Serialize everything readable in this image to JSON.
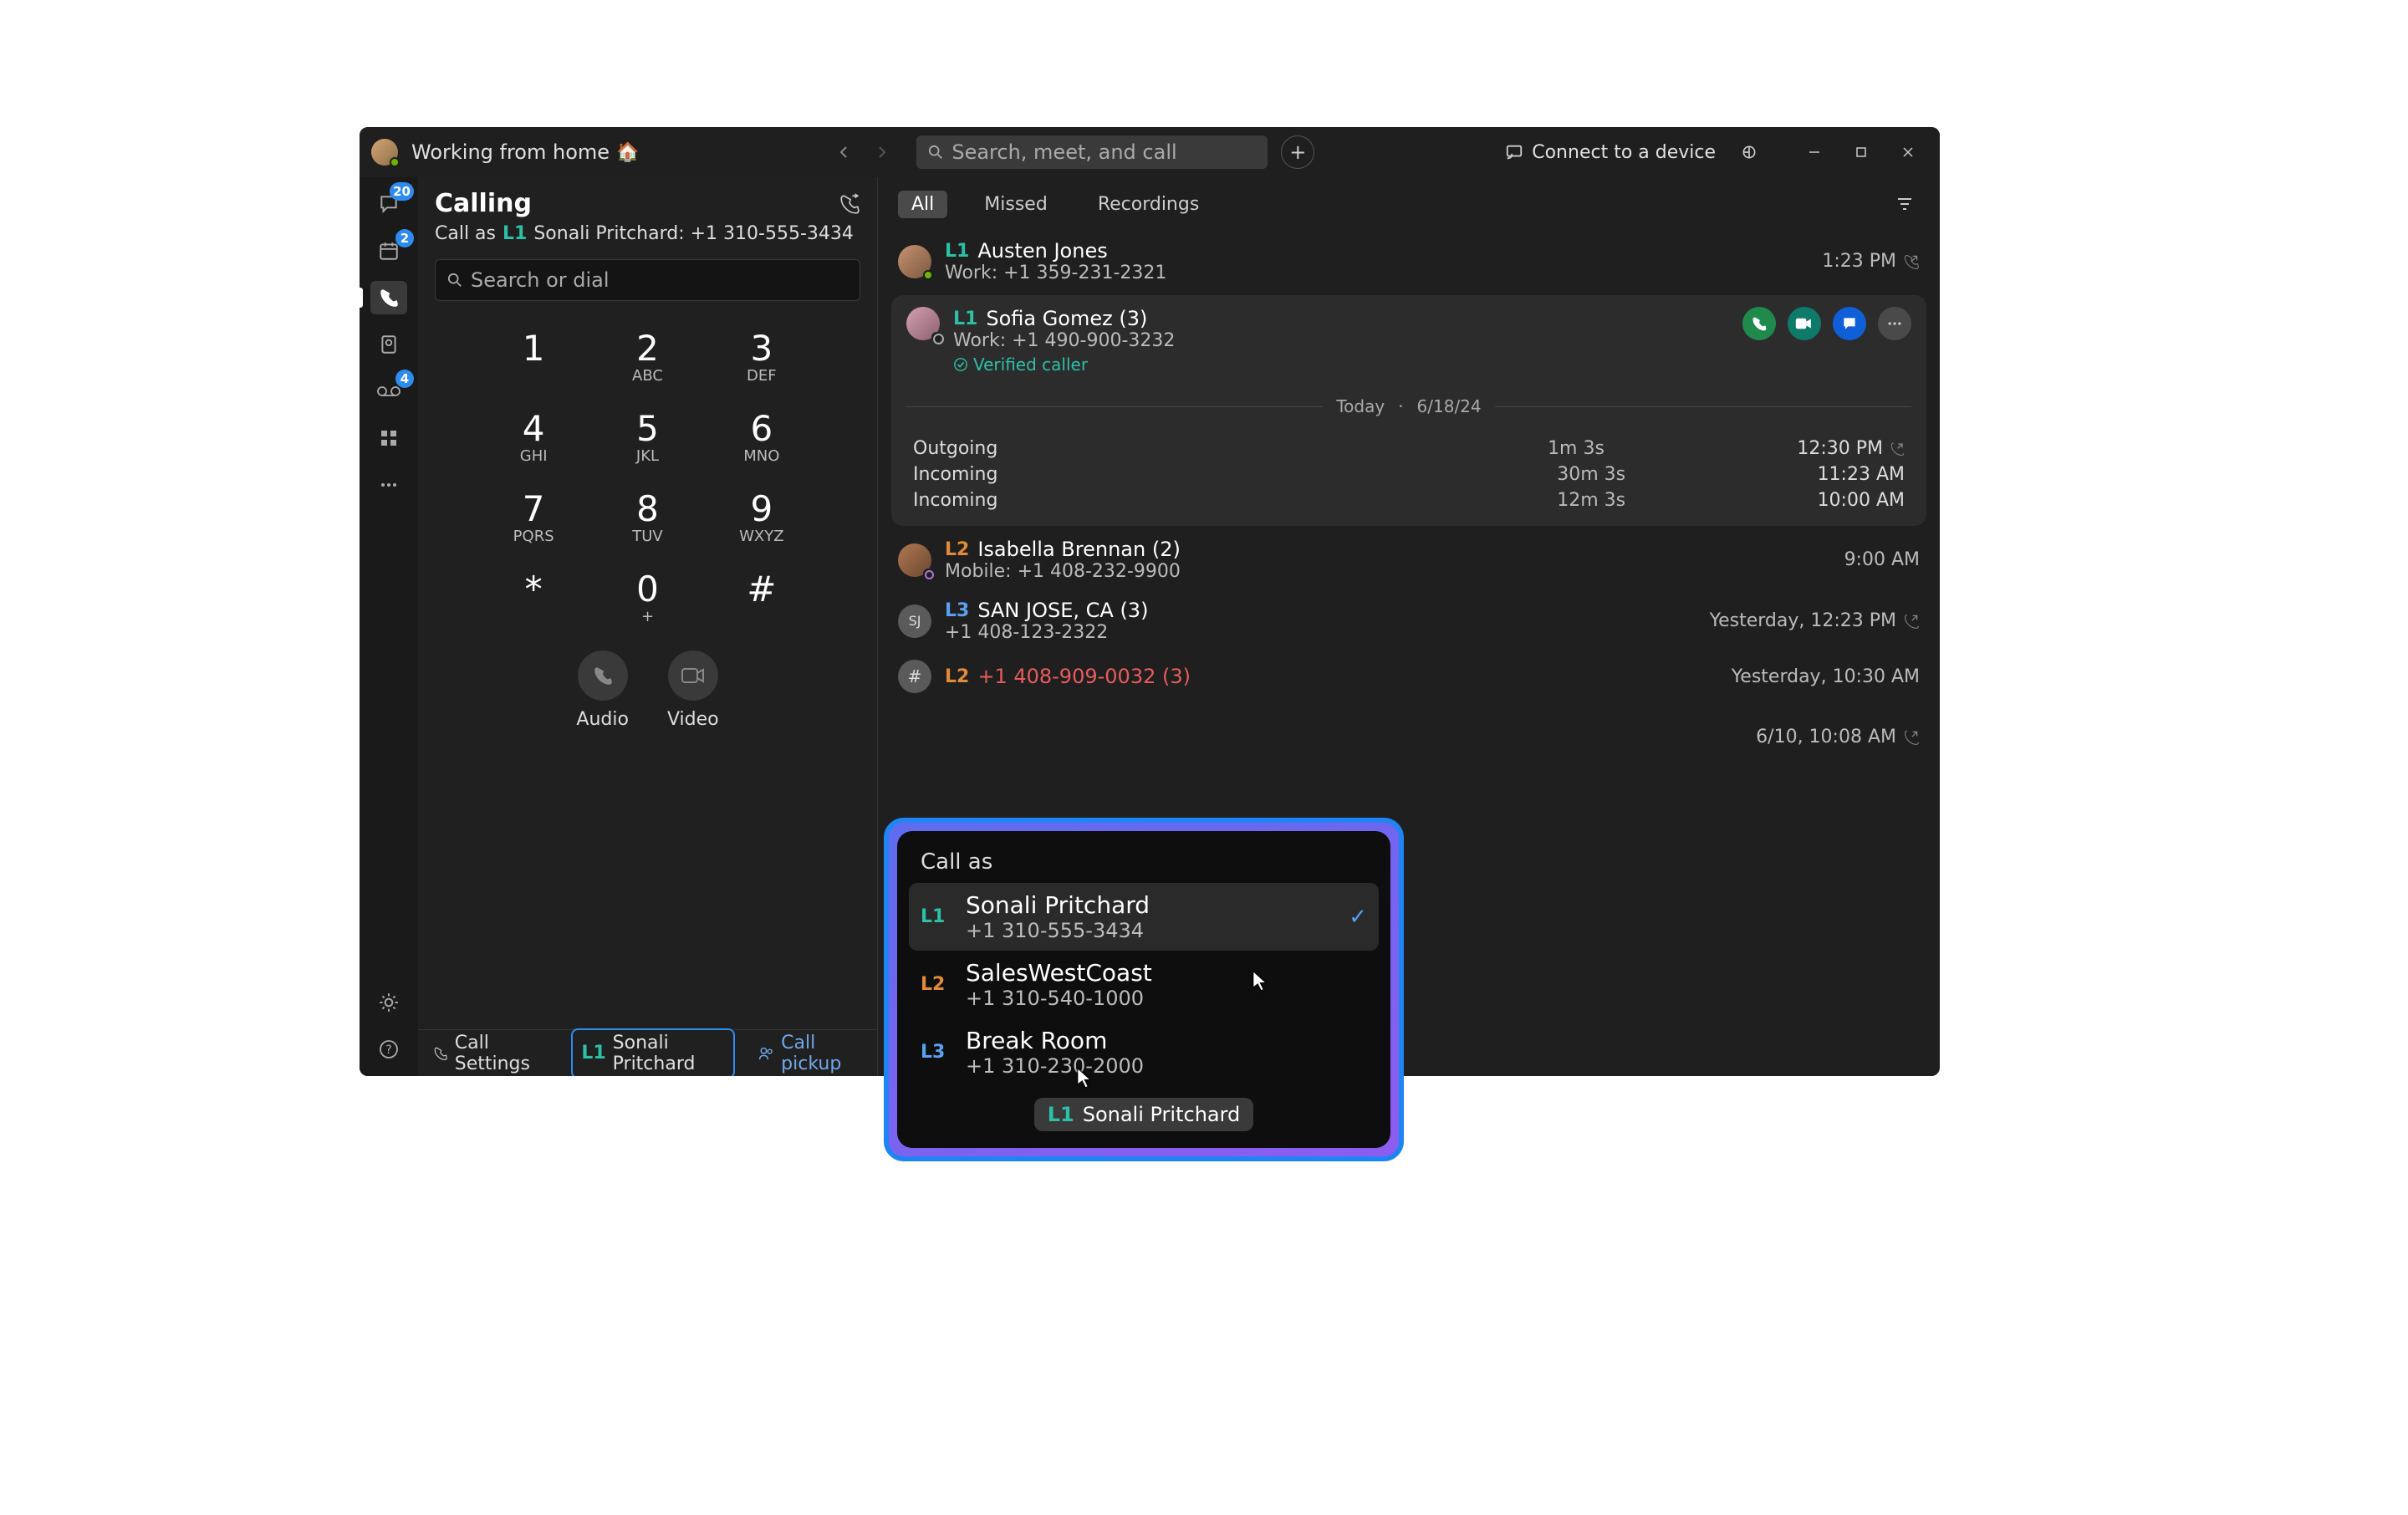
{
  "titlebar": {
    "status": "Working from home",
    "emoji": "🏠",
    "search_placeholder": "Search, meet, and call",
    "connect": "Connect to a device"
  },
  "leftrail": {
    "chat_badge": "20",
    "calendar_badge": "2",
    "voicemail_badge": "4"
  },
  "calling": {
    "title": "Calling",
    "call_as_prefix": "Call as",
    "call_as_line": "L1",
    "call_as_name": "Sonali Pritchard: +1 310-555-3434",
    "search_placeholder": "Search or dial",
    "keys": [
      {
        "num": "1",
        "letters": ""
      },
      {
        "num": "2",
        "letters": "ABC"
      },
      {
        "num": "3",
        "letters": "DEF"
      },
      {
        "num": "4",
        "letters": "GHI"
      },
      {
        "num": "5",
        "letters": "JKL"
      },
      {
        "num": "6",
        "letters": "MNO"
      },
      {
        "num": "7",
        "letters": "PQRS"
      },
      {
        "num": "8",
        "letters": "TUV"
      },
      {
        "num": "9",
        "letters": "WXYZ"
      },
      {
        "num": "*",
        "letters": ""
      },
      {
        "num": "0",
        "letters": "+"
      },
      {
        "num": "#",
        "letters": ""
      }
    ],
    "audio_label": "Audio",
    "video_label": "Video"
  },
  "footer": {
    "call_settings": "Call Settings",
    "line_pill_line": "L1",
    "line_pill_name": "Sonali Pritchard",
    "call_pickup": "Call pickup"
  },
  "history": {
    "tabs": {
      "all": "All",
      "missed": "Missed",
      "recordings": "Recordings"
    },
    "rows": [
      {
        "line": "L1",
        "name": "Austen Jones",
        "sub": "Work: +1 359-231-2321",
        "time": "1:23 PM",
        "out": true,
        "line_class": ""
      },
      {
        "line": "L2",
        "name": "Isabella Brennan (2)",
        "sub": "Mobile: +1 408-232-9900",
        "time": "9:00 AM",
        "out": false,
        "line_class": "l2"
      },
      {
        "line": "L3",
        "name": "SAN JOSE, CA (3)",
        "sub": "+1 408-123-2322",
        "time": "Yesterday, 12:23 PM",
        "out": true,
        "line_class": "l3"
      },
      {
        "line": "L2",
        "name": "+1 408-909-0032 (3)",
        "sub": "",
        "time": "Yesterday, 10:30 AM",
        "out": false,
        "line_class": "l2",
        "missed": true
      }
    ],
    "expanded": {
      "line": "L1",
      "name": "Sofia Gomez (3)",
      "sub": "Work: +1 490-900-3232",
      "verified": "Verified caller",
      "divider_today": "Today",
      "divider_date": "6/18/24",
      "details": [
        {
          "dir": "Outgoing",
          "dur": "1m 3s",
          "when": "12:30 PM",
          "out": true
        },
        {
          "dir": "Incoming",
          "dur": "30m 3s",
          "when": "11:23 AM",
          "out": false
        },
        {
          "dir": "Incoming",
          "dur": "12m 3s",
          "when": "10:00 AM",
          "out": false
        }
      ]
    },
    "last_row_time": "6/10, 10:08 AM"
  },
  "popover": {
    "title": "Call as",
    "items": [
      {
        "line": "L1",
        "name": "Sonali Pritchard",
        "num": "+1 310-555-3434",
        "selected": true,
        "cls": ""
      },
      {
        "line": "L2",
        "name": "SalesWestCoast",
        "num": "+1 310-540-1000",
        "selected": false,
        "cls": "l2"
      },
      {
        "line": "L3",
        "name": "Break Room",
        "num": "+1 310-230-2000",
        "selected": false,
        "cls": "l3"
      }
    ],
    "pill_line": "L1",
    "pill_name": "Sonali Pritchard"
  }
}
